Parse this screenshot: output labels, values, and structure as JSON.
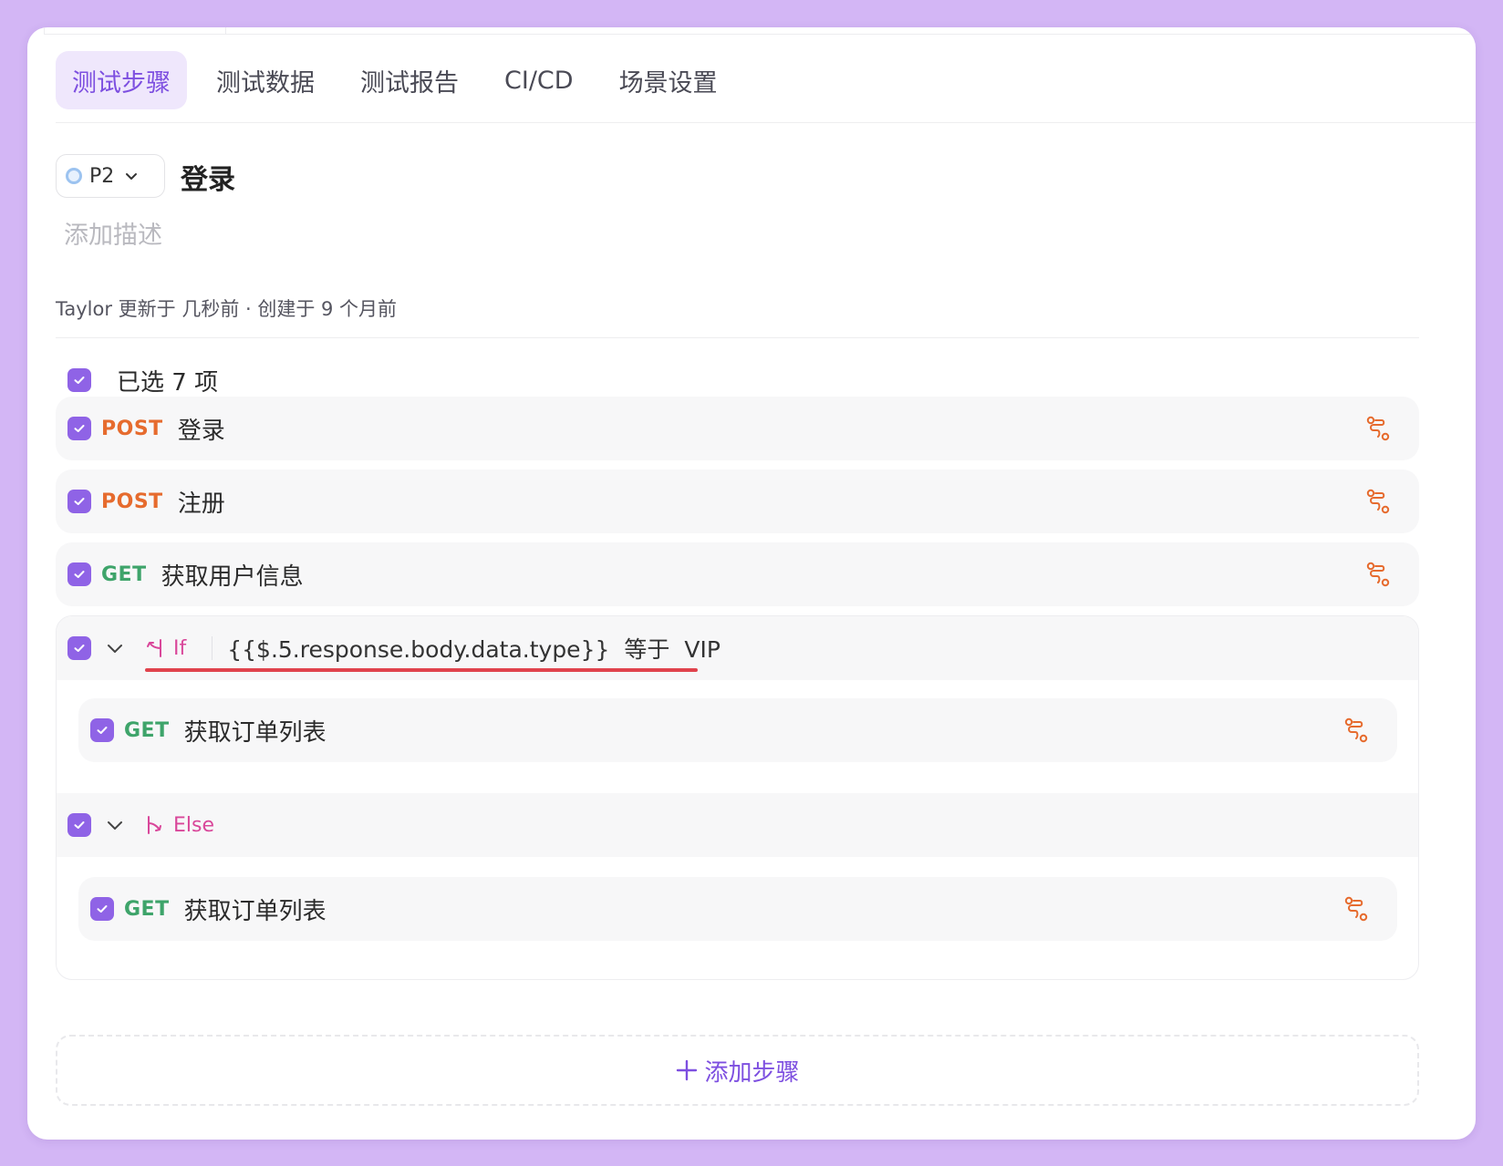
{
  "tabs": [
    {
      "label": "测试步骤",
      "active": true
    },
    {
      "label": "测试数据",
      "active": false
    },
    {
      "label": "测试报告",
      "active": false
    },
    {
      "label": "CI/CD",
      "active": false
    },
    {
      "label": "场景设置",
      "active": false
    }
  ],
  "scenario": {
    "priority": "P2",
    "title": "登录",
    "description_placeholder": "添加描述",
    "meta": "Taylor 更新于 几秒前 · 创建于 9 个月前"
  },
  "selection": {
    "label": "已选 7 项"
  },
  "steps": [
    {
      "method": "POST",
      "name": "登录"
    },
    {
      "method": "POST",
      "name": "注册"
    },
    {
      "method": "GET",
      "name": "获取用户信息"
    }
  ],
  "if_branch": {
    "label": "If",
    "condition_var": "{{$.5.response.body.data.type}}",
    "operator": "等于",
    "value": "VIP",
    "step": {
      "method": "GET",
      "name": "获取订单列表"
    }
  },
  "else_branch": {
    "label": "Else",
    "step": {
      "method": "GET",
      "name": "获取订单列表"
    }
  },
  "add_step": {
    "label": "添加步骤"
  },
  "colors": {
    "accent": "#8f63e6",
    "post": "#e66b2e",
    "get": "#3ea46a",
    "branch": "#d9479a",
    "underline": "#e0434d"
  }
}
